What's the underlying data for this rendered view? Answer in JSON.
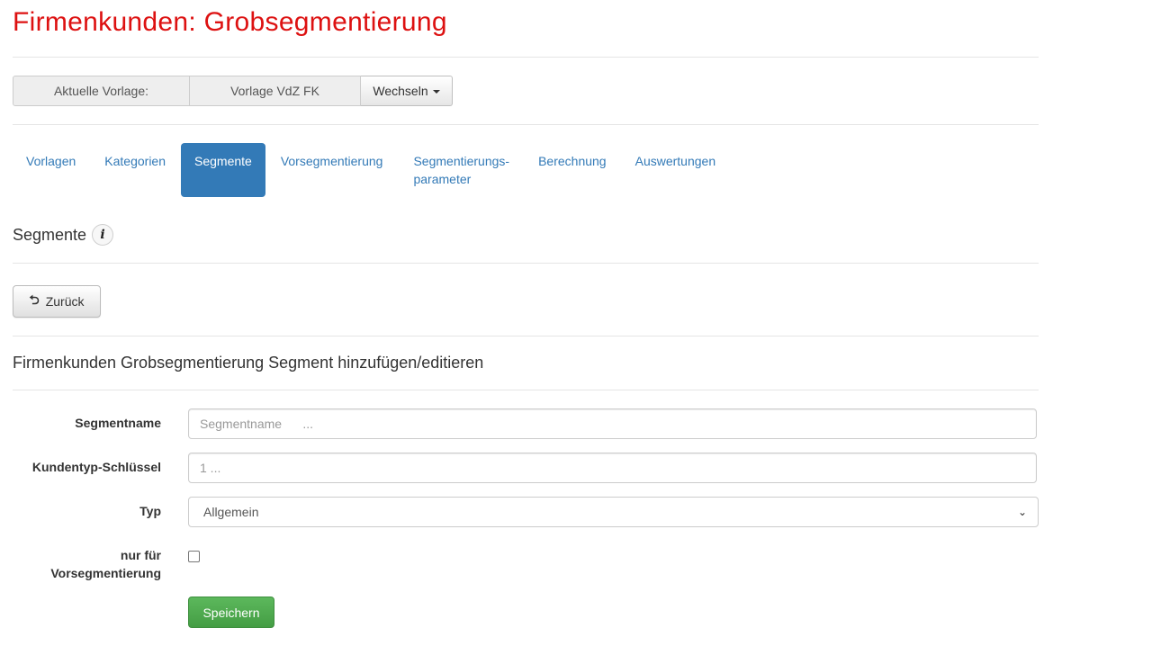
{
  "page": {
    "title": "Firmenkunden: Grobsegmentierung"
  },
  "vorlage": {
    "current_label": "Aktuelle Vorlage:",
    "current_value": "Vorlage VdZ FK",
    "switch_label": "Wechseln"
  },
  "tabs": [
    {
      "label": "Vorlagen",
      "active": false
    },
    {
      "label": "Kategorien",
      "active": false
    },
    {
      "label": "Segmente",
      "active": true
    },
    {
      "label": "Vorsegmentierung",
      "active": false
    },
    {
      "label": "Segmentierungs-\nparameter",
      "active": false
    },
    {
      "label": "Berechnung",
      "active": false
    },
    {
      "label": "Auswertungen",
      "active": false
    }
  ],
  "section": {
    "heading": "Segmente",
    "info_icon": "i"
  },
  "back_button": {
    "label": "Zurück",
    "icon": "back-arrow-icon"
  },
  "form": {
    "heading": "Firmenkunden Grobsegmentierung Segment hinzufügen/editieren",
    "fields": {
      "segmentname": {
        "label": "Segmentname",
        "placeholder": "Segmentname      ...",
        "value": ""
      },
      "kundentyp": {
        "label": "Kundentyp-Schlüssel",
        "placeholder": "1 ...",
        "value": ""
      },
      "typ": {
        "label": "Typ",
        "selected": "Allgemein"
      },
      "vorseg": {
        "label_line1": "nur für",
        "label_line2": "Vorsegmentierung",
        "checked": false
      }
    },
    "save_label": "Speichern"
  },
  "colors": {
    "title": "#dd1111",
    "link": "#337ab7",
    "active_tab": "#337ab7",
    "save": "#5cb85c"
  }
}
